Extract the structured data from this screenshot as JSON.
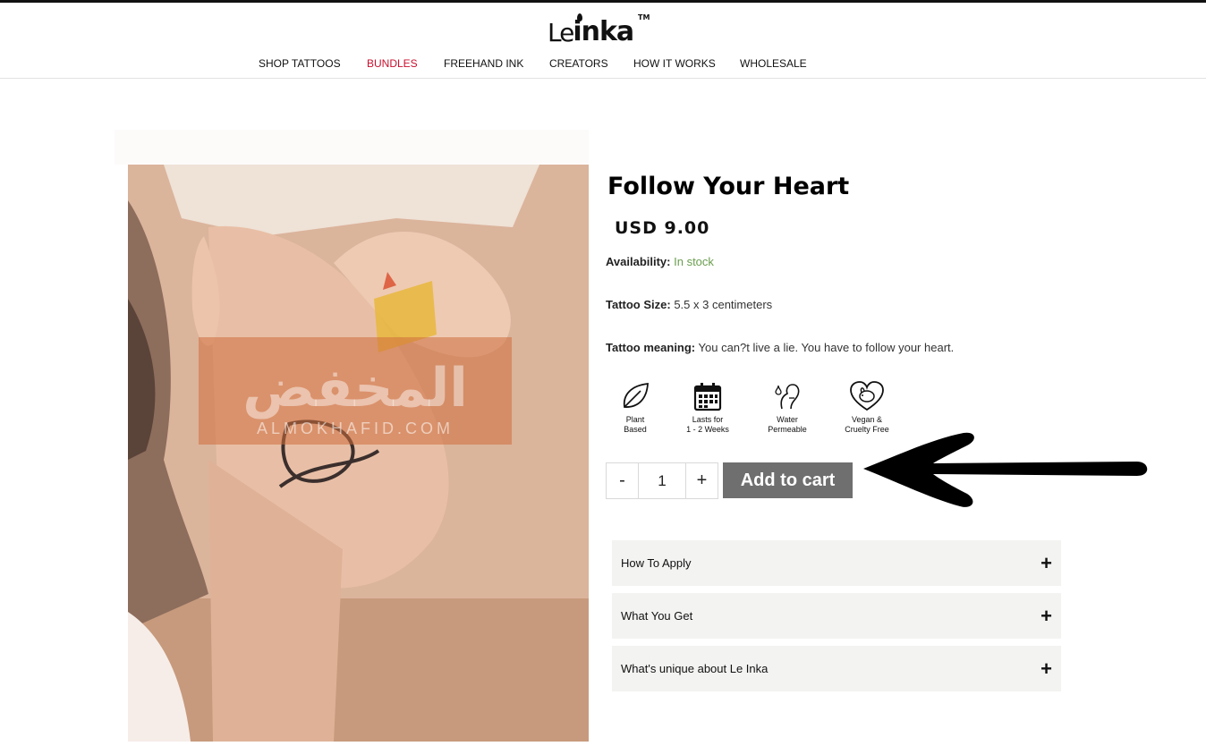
{
  "brand": {
    "logo_le": "Le",
    "logo_inka": "inka",
    "trademark": "TM"
  },
  "nav": [
    {
      "label": "SHOP TATTOOS",
      "active": false
    },
    {
      "label": "BUNDLES",
      "active": true
    },
    {
      "label": "FREEHAND INK",
      "active": false
    },
    {
      "label": "CREATORS",
      "active": false
    },
    {
      "label": "HOW IT WORKS",
      "active": false
    },
    {
      "label": "WHOLESALE",
      "active": false
    }
  ],
  "watermark": {
    "arabic": "المخفض",
    "latin": "ALMOKHAFID.COM"
  },
  "product": {
    "title": "Follow Your Heart",
    "price": "USD 9.00",
    "availability_label": "Availability:",
    "availability_value": "In stock",
    "size_label": "Tattoo Size:",
    "size_value": "5.5 x 3 centimeters",
    "meaning_label": "Tattoo meaning:",
    "meaning_value": "You can?t live a lie. You have to follow your heart."
  },
  "features": [
    {
      "icon": "leaf-icon",
      "line1": "Plant",
      "line2": "Based"
    },
    {
      "icon": "calendar-icon",
      "line1": "Lasts for",
      "line2": "1 - 2 Weeks"
    },
    {
      "icon": "water-drop-icon",
      "line1": "Water",
      "line2": "Permeable"
    },
    {
      "icon": "rabbit-heart-icon",
      "line1": "Vegan &",
      "line2": "Cruelty Free"
    }
  ],
  "cart": {
    "minus": "-",
    "quantity": "1",
    "plus": "+",
    "add_to_cart": "Add to cart"
  },
  "accordion": [
    {
      "label": "How To Apply",
      "icon": "+"
    },
    {
      "label": "What You Get",
      "icon": "+"
    },
    {
      "label": "What's unique about Le Inka",
      "icon": "+"
    }
  ],
  "colors": {
    "nav_active": "#c8102e",
    "in_stock": "#6a9e4f",
    "add_to_cart_bg": "#6f6f6f",
    "accordion_bg": "#f3f3f2"
  }
}
